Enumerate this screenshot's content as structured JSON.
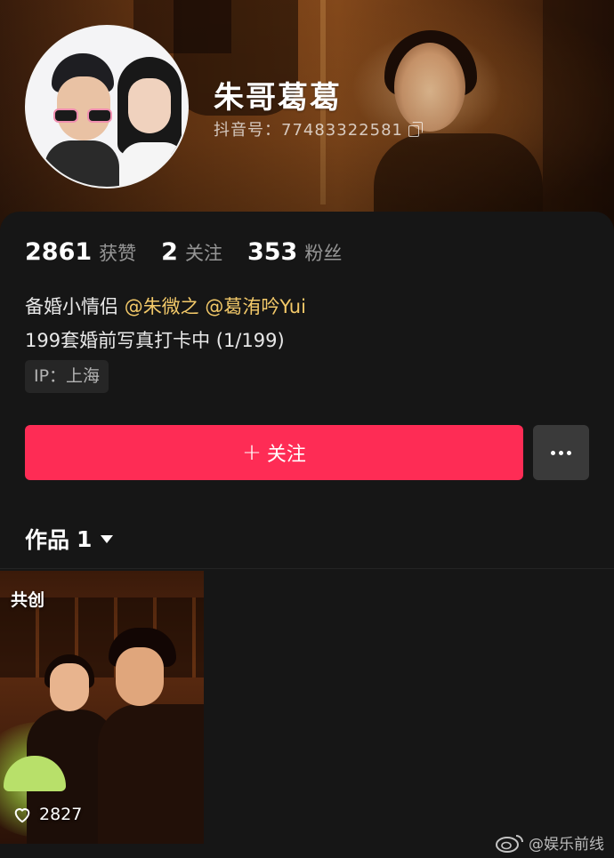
{
  "profile": {
    "nickname": "朱哥葛葛",
    "douyin_id": "抖音号：77483322581"
  },
  "stats": [
    {
      "value": "2861",
      "label": "获赞"
    },
    {
      "value": "2",
      "label": "关注"
    },
    {
      "value": "353",
      "label": "粉丝"
    }
  ],
  "bio": {
    "prefix": "备婚小情侣 ",
    "mention_1": "@朱微之",
    "mention_2": "@葛洧吟Yui",
    "line2": "199套婚前写真打卡中 (1/199)"
  },
  "ip_tag": "IP：上海",
  "actions": {
    "follow_plus": "+",
    "follow_label": "关注"
  },
  "works_tab": {
    "label": "作品",
    "count": "1"
  },
  "videos": [
    {
      "badge": "共创",
      "likes": "2827"
    }
  ],
  "watermark": "@娱乐前线",
  "colors": {
    "accent": "#fe2c55",
    "mention": "#f3c969",
    "background": "#161616"
  }
}
